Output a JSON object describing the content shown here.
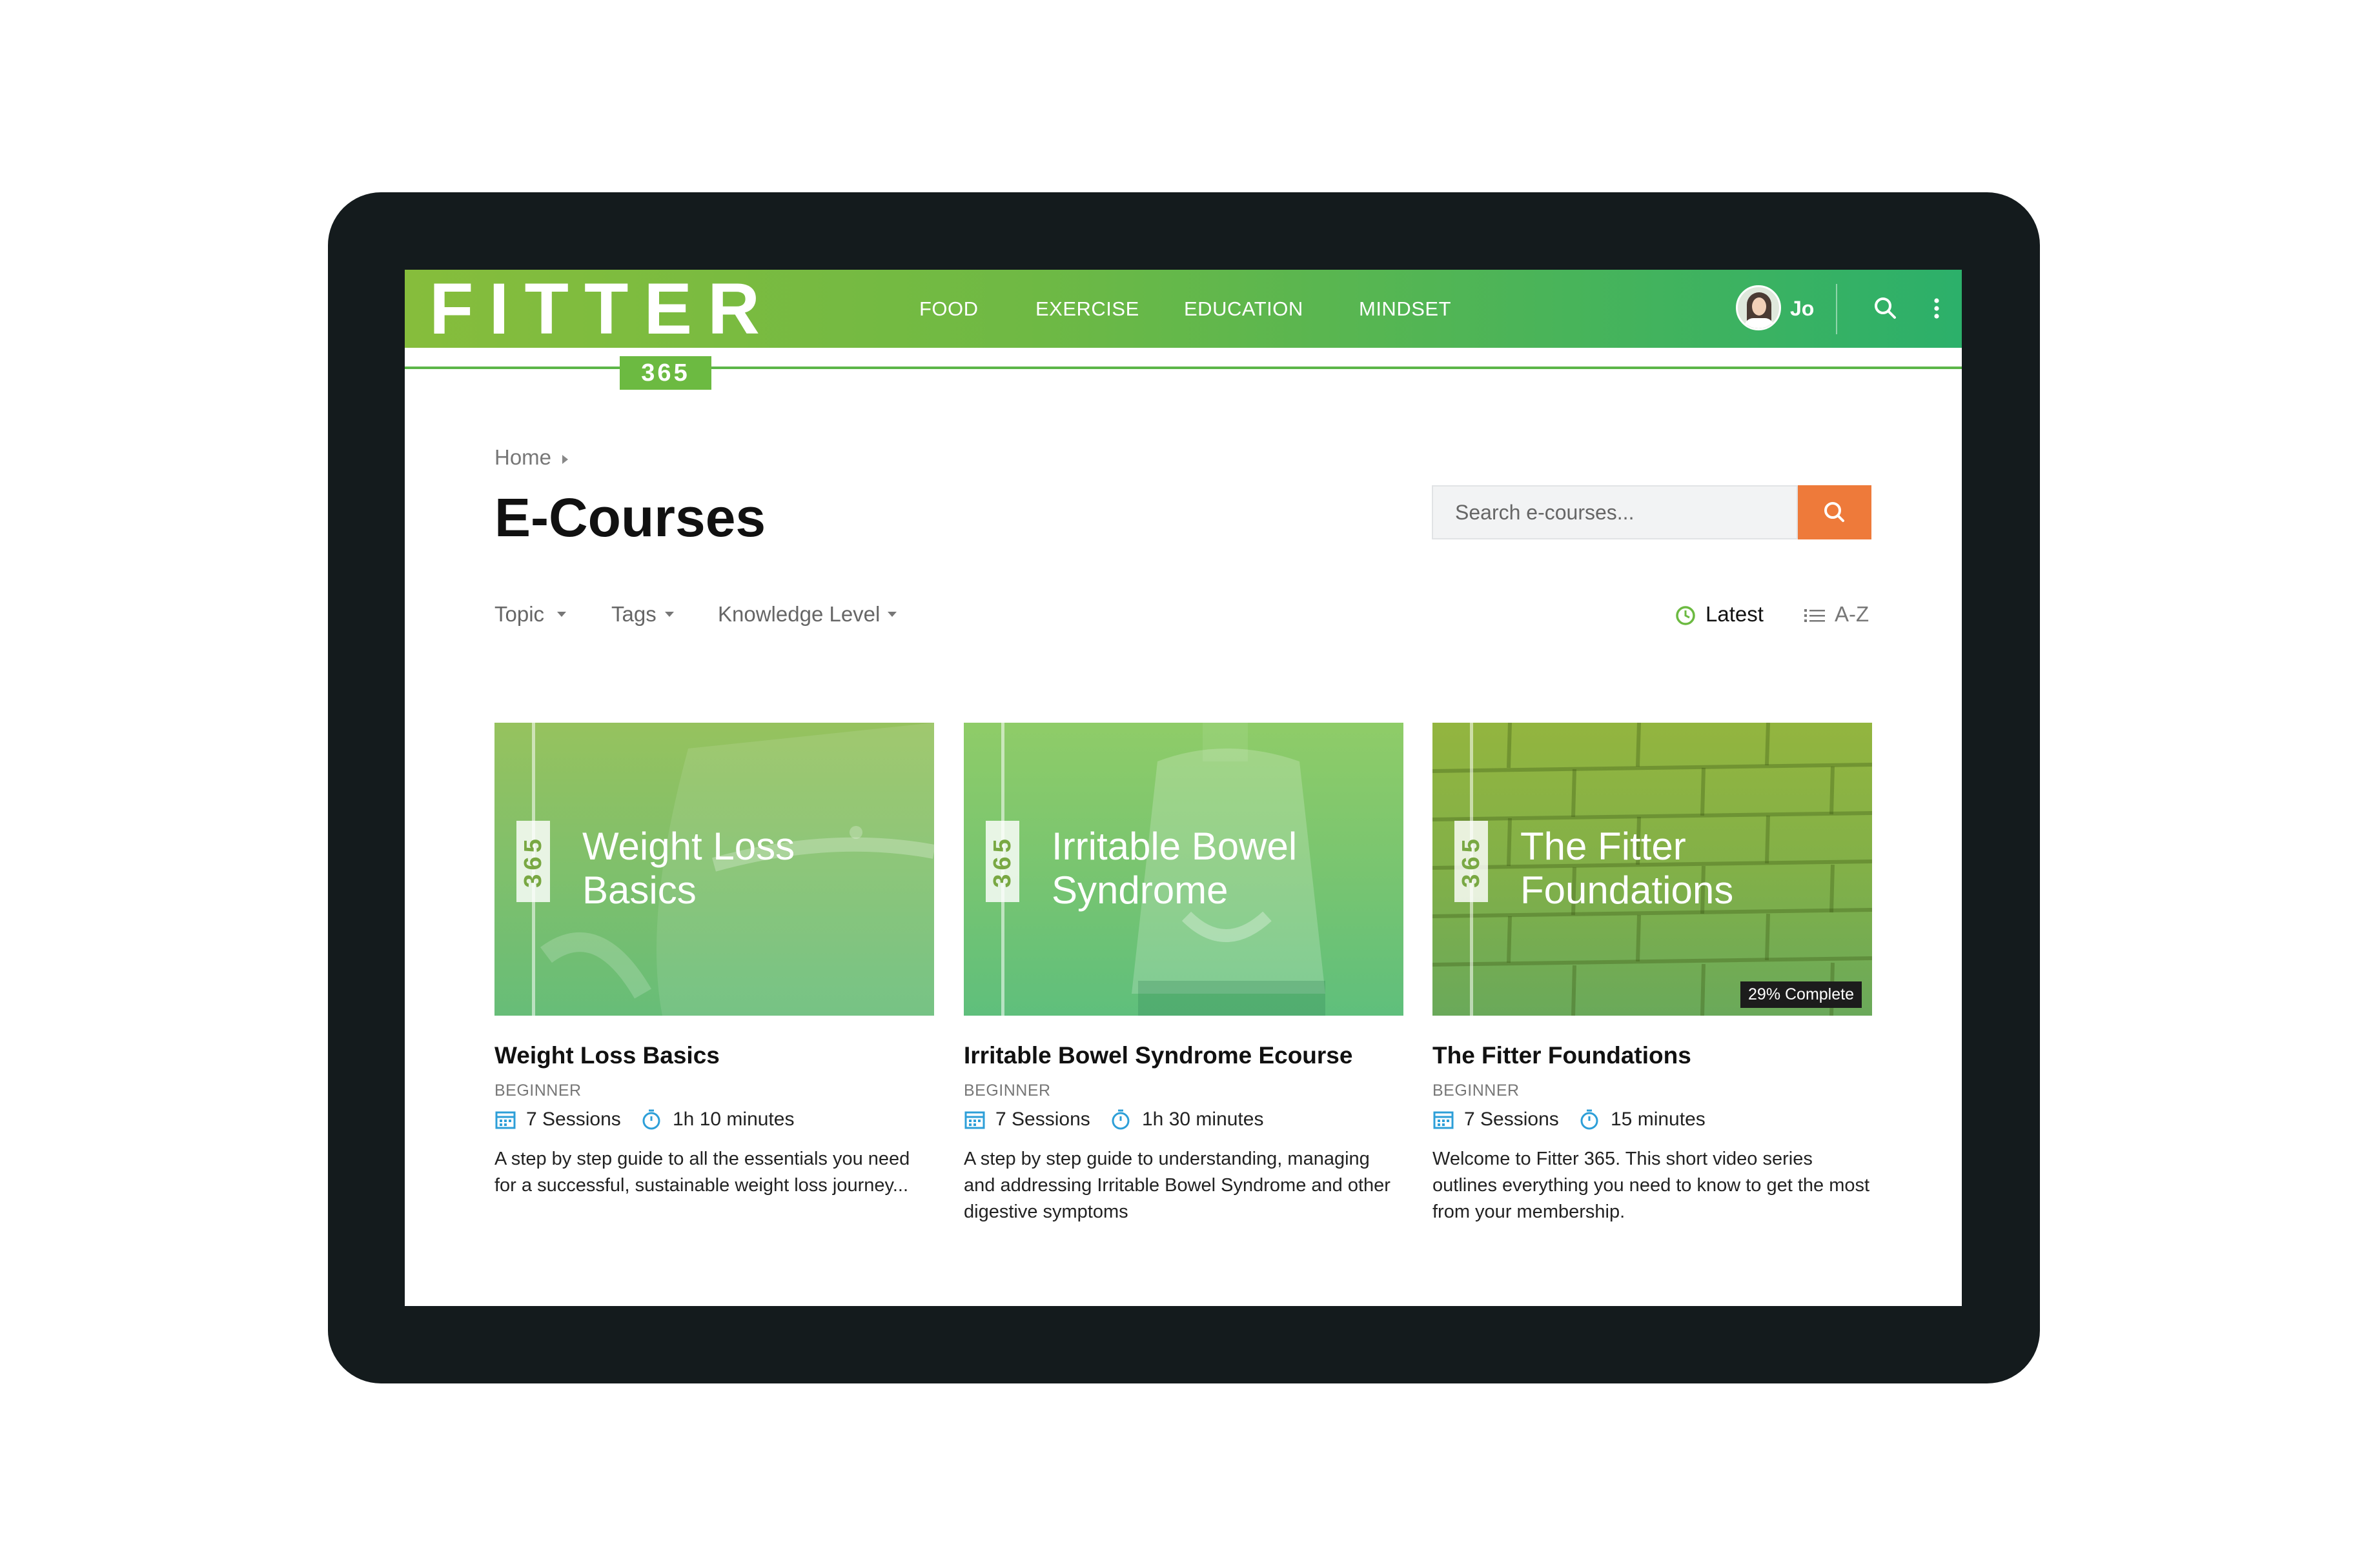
{
  "header": {
    "logo_text": "FITTER",
    "logo_badge": "365",
    "nav": [
      "FOOD",
      "EXERCISE",
      "EDUCATION",
      "MINDSET"
    ],
    "user_name": "Jo",
    "icons": [
      "avatar",
      "search-icon",
      "more-vertical-icon"
    ]
  },
  "page": {
    "breadcrumb": "Home",
    "title": "E-Courses",
    "search_placeholder": "Search e-courses..."
  },
  "filters": [
    "Topic",
    "Tags",
    "Knowledge Level"
  ],
  "sort": {
    "latest": "Latest",
    "az": "A-Z",
    "active": "Latest"
  },
  "colors": {
    "accent": "#ee7a3a",
    "brand_green": "#6cba41",
    "icon_blue": "#2d9fd8"
  },
  "courses": [
    {
      "image_title": "Weight Loss Basics",
      "badge": "365",
      "title": "Weight Loss Basics",
      "level": "BEGINNER",
      "sessions": "7 Sessions",
      "duration": "1h 10 minutes",
      "description": "A step by step guide to all the essentials you need for a successful, sustainable weight loss journey..."
    },
    {
      "image_title": "Irritable Bowel Syndrome",
      "badge": "365",
      "title": "Irritable Bowel Syndrome Ecourse",
      "level": "BEGINNER",
      "sessions": "7 Sessions",
      "duration": "1h 30 minutes",
      "description": "A step by step guide to understanding, managing and addressing Irritable Bowel Syndrome and other digestive symptoms"
    },
    {
      "image_title": "The Fitter Foundations",
      "badge": "365",
      "title": "The Fitter Foundations",
      "level": "BEGINNER",
      "sessions": "7 Sessions",
      "duration": "15 minutes",
      "description": "Welcome to Fitter 365. This short video series outlines everything you need to know to get the most from your membership.",
      "progress_label": "29% Complete",
      "progress": 0.29
    }
  ]
}
